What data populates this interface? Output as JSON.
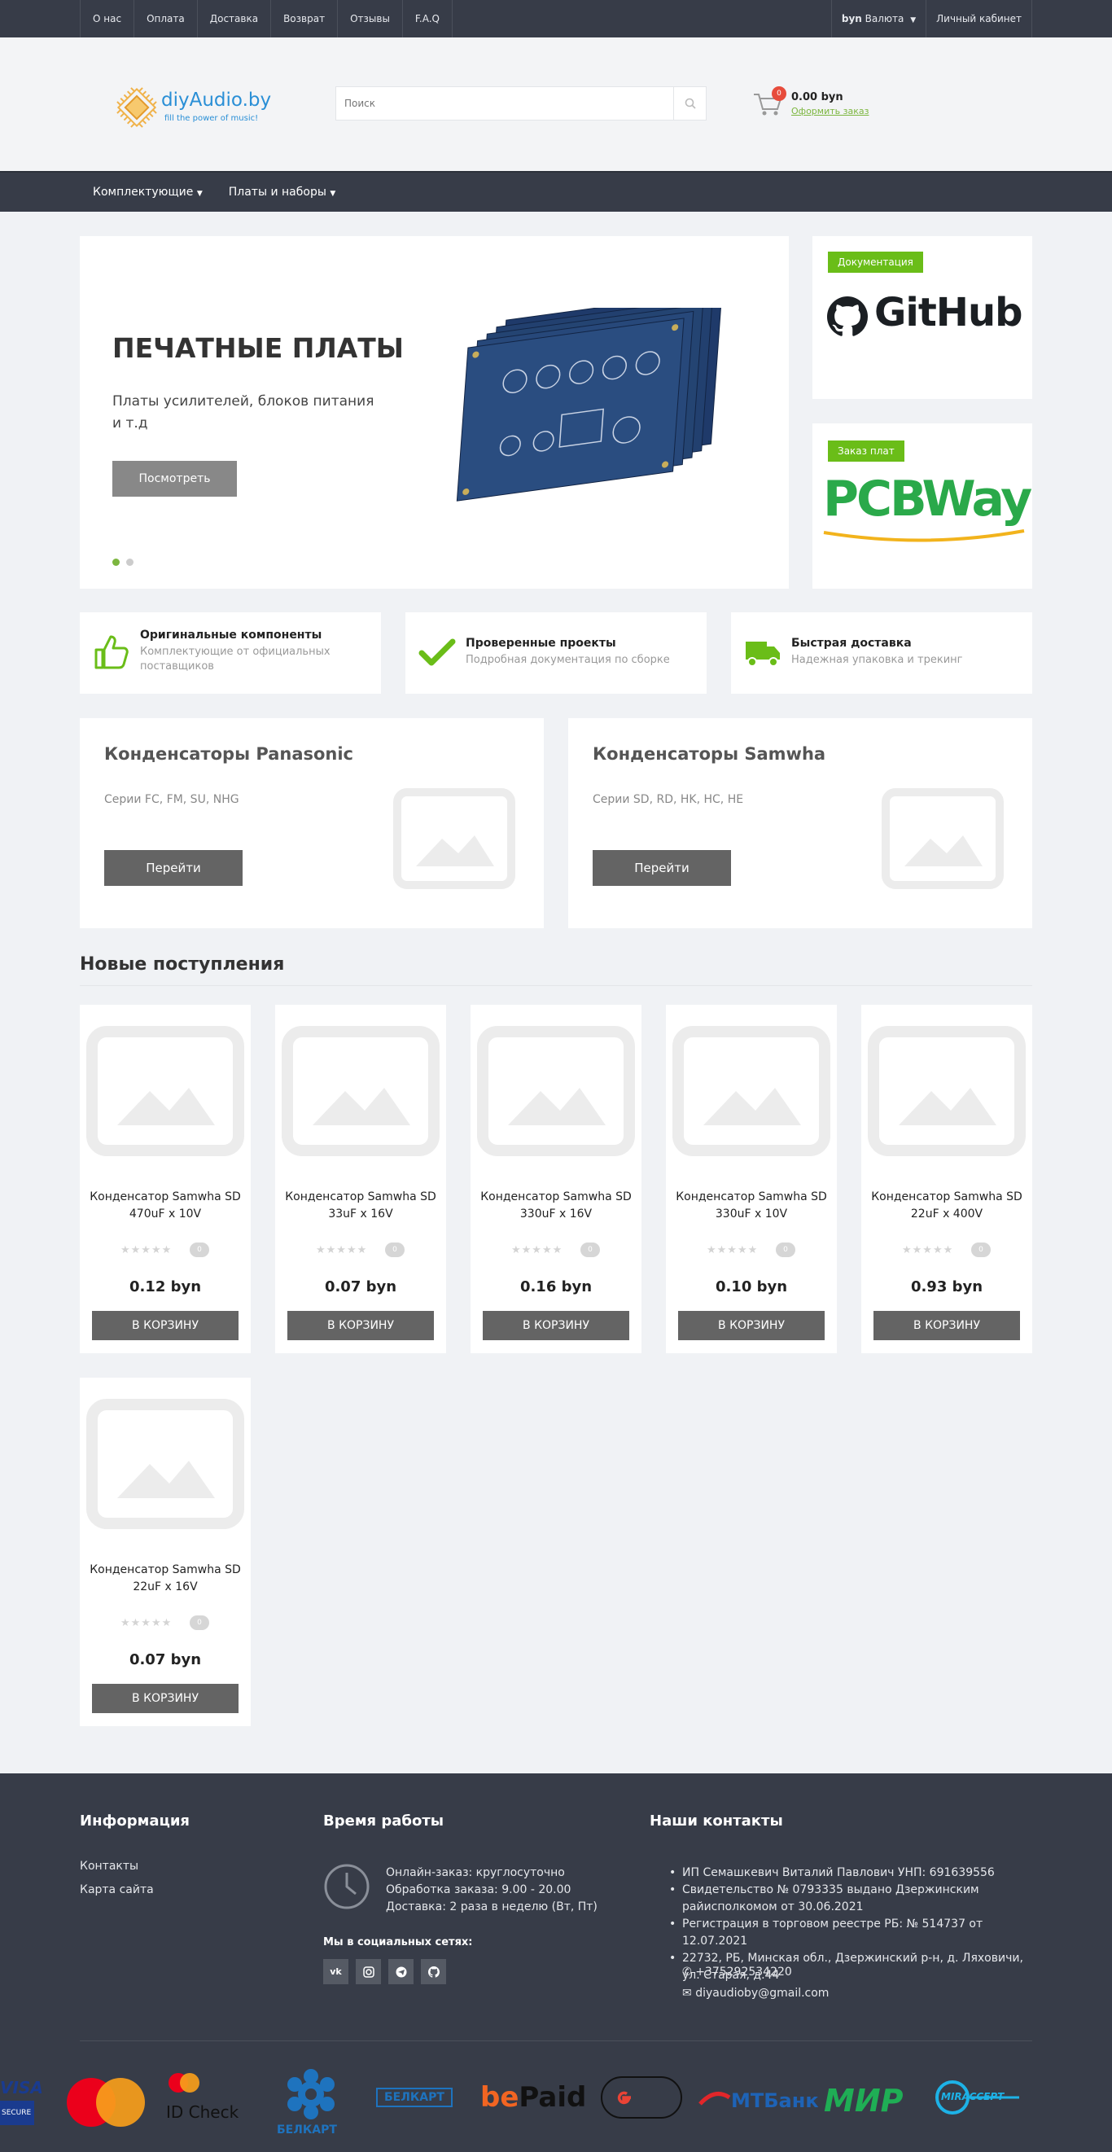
{
  "topbar": {
    "links": [
      "О нас",
      "Оплата",
      "Доставка",
      "Возврат",
      "Отзывы",
      "F.A.Q"
    ],
    "currency_code": "byn",
    "currency_label": "Валюта",
    "account": "Личный кабинет"
  },
  "header": {
    "logo_name": "diyAudio.by",
    "logo_tagline": "fill the power of music!",
    "search_placeholder": "Поиск",
    "cart_count": "0",
    "cart_total": "0.00 byn",
    "cart_checkout": "Оформить заказ"
  },
  "mainnav": {
    "items": [
      "Комплектующие",
      "Платы и наборы"
    ]
  },
  "slider": {
    "title": "ПЕЧАТНЫЕ ПЛАТЫ",
    "text": "Платы усилителей, блоков питания и т.д",
    "button": "Посмотреть"
  },
  "promos": [
    {
      "tag": "Документация",
      "brand": "GitHub"
    },
    {
      "tag": "Заказ плат",
      "brand": "PCBWay"
    }
  ],
  "features": [
    {
      "title": "Оригинальные компоненты",
      "subtitle": "Комплектующие от официальных поставщиков"
    },
    {
      "title": "Проверенные проекты",
      "subtitle": "Подробная документация по сборке"
    },
    {
      "title": "Быстрая доставка",
      "subtitle": "Надежная упаковка и трекинг"
    }
  ],
  "categories": [
    {
      "title": "Конденсаторы Panasonic",
      "series": "Серии FC, FM, SU, NHG",
      "button": "Перейти"
    },
    {
      "title": "Конденсаторы Samwha",
      "series": "Серии SD, RD, HK, HC, HE",
      "button": "Перейти"
    }
  ],
  "new_arrivals": {
    "title": "Новые поступления",
    "stars": "★★★★★",
    "products": [
      {
        "name": "Конденсатор Samwha SD 470uF x 10V",
        "price": "0.12 byn",
        "reviews": "0",
        "button": "В КОРЗИНУ"
      },
      {
        "name": "Конденсатор Samwha SD 33uF x 16V",
        "price": "0.07 byn",
        "reviews": "0",
        "button": "В КОРЗИНУ"
      },
      {
        "name": "Конденсатор Samwha SD 330uF x 16V",
        "price": "0.16 byn",
        "reviews": "0",
        "button": "В КОРЗИНУ"
      },
      {
        "name": "Конденсатор Samwha SD 330uF x 10V",
        "price": "0.10 byn",
        "reviews": "0",
        "button": "В КОРЗИНУ"
      },
      {
        "name": "Конденсатор Samwha SD 22uF x 400V",
        "price": "0.93 byn",
        "reviews": "0",
        "button": "В КОРЗИНУ"
      },
      {
        "name": "Конденсатор Samwha SD 22uF x 16V",
        "price": "0.07 byn",
        "reviews": "0",
        "button": "В КОРЗИНУ"
      }
    ]
  },
  "footer": {
    "info_title": "Информация",
    "info_links": [
      "Контакты",
      "Карта сайта"
    ],
    "hours_title": "Время работы",
    "hours": [
      "Онлайн-заказ: круглосуточно",
      "Обработка заказа: 9.00 - 20.00",
      "Доставка: 2 раза в неделю (Вт, Пт)"
    ],
    "social_title": "Мы в социальных сетях:",
    "contacts_title": "Наши контакты",
    "contacts": [
      "ИП Семашкевич Виталий Павлович УНП: 691639556",
      "Свидетельство № 0793335 выдано Дзержинским райисполкомом от 30.06.2021",
      "Регистрация в торговом реестре РБ: № 514737 от 12.07.2021",
      "22732, РБ, Минская обл., Дзержинский р-н, д. Ляховичи, ул. Старая, д.44"
    ],
    "phone": "+375292534220",
    "email": "diyaudioby@gmail.com"
  },
  "payments": {
    "visa": "VISA",
    "visa_secure": "SECURE",
    "id_check": "ID Check",
    "belkart": "БЕЛКАРТ",
    "belkart_internet": "БЕЛКАРТ",
    "bepaid_be": "be",
    "bepaid_paid": "Paid",
    "mtbank": "МТБанк",
    "mir": "МИР",
    "mir_accept": "MIRACCEPT"
  }
}
